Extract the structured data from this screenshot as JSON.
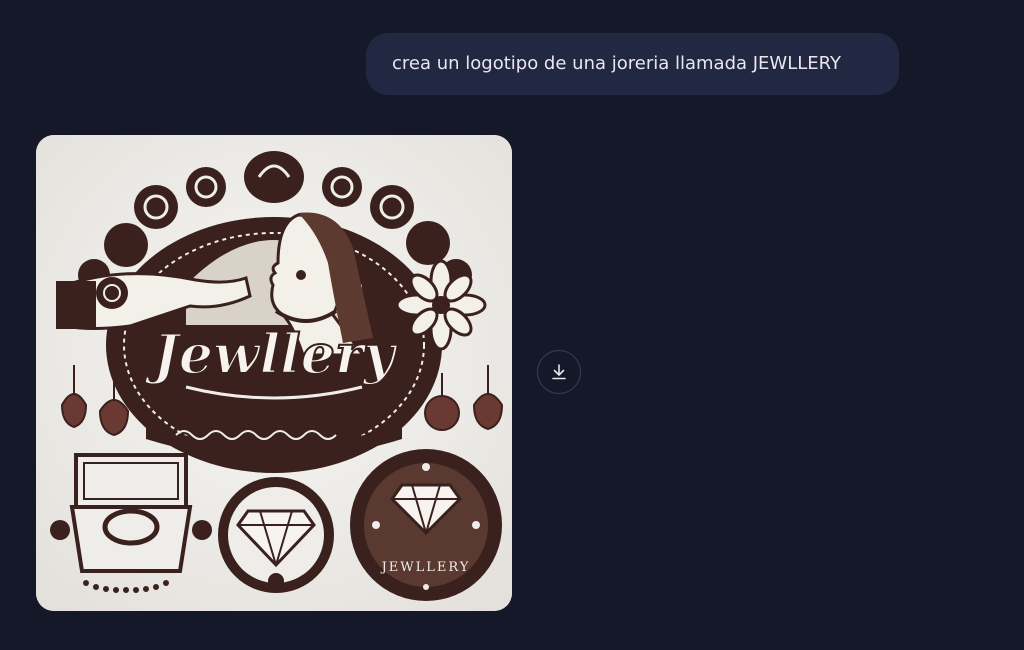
{
  "conversation": {
    "user_message": "crea un logotipo de una joreria llamada JEWLLERY"
  },
  "generated_image": {
    "logo_text": "Jewllery",
    "bottom_seal_text": "JEWLLERY"
  },
  "actions": {
    "download_icon": "download-icon"
  },
  "colors": {
    "background": "#141829",
    "bubble": "#222842",
    "ink": "#3a211d",
    "paper": "#efedea"
  }
}
